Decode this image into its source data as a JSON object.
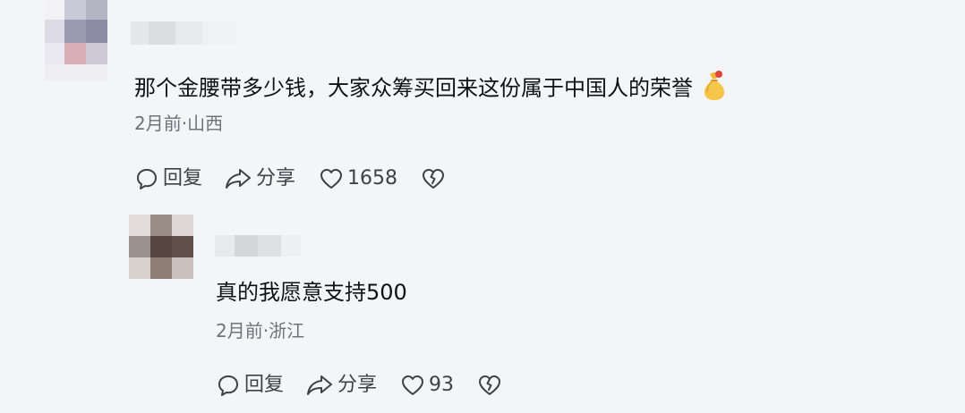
{
  "comments": [
    {
      "text": "那个金腰带多少钱，大家众筹买回来这份属于中国人的荣誉",
      "emoji": "money-bag-emoji",
      "time_location": "2月前·山西",
      "actions": {
        "reply_label": "回复",
        "share_label": "分享",
        "like_count": "1658"
      }
    },
    {
      "text": "真的我愿意支持500",
      "time_location": "2月前·浙江",
      "actions": {
        "reply_label": "回复",
        "share_label": "分享",
        "like_count": "93"
      }
    }
  ],
  "colors": {
    "background": "#f4f5f7",
    "text": "#111111",
    "meta": "#6f7278",
    "action": "#3e4146"
  }
}
